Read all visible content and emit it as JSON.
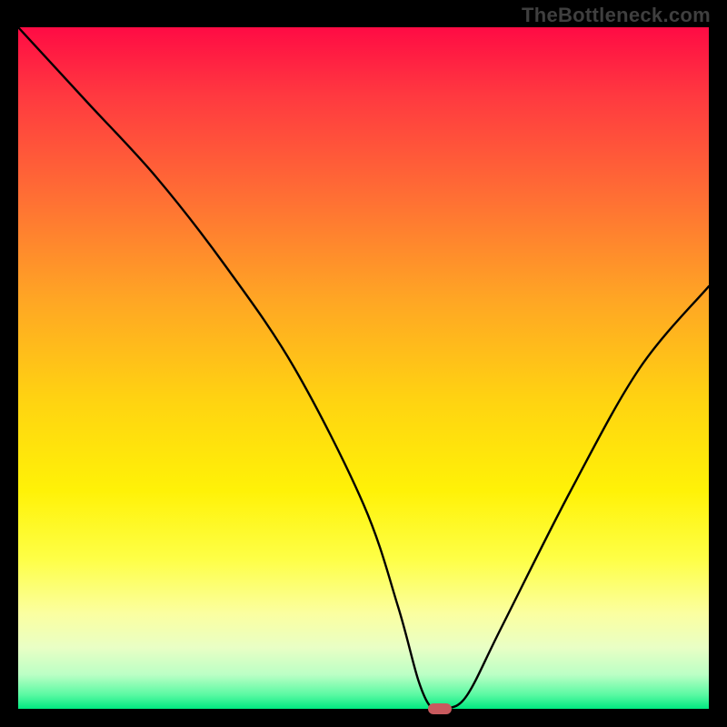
{
  "watermark": "TheBottleneck.com",
  "chart_data": {
    "type": "line",
    "title": "",
    "xlabel": "",
    "ylabel": "",
    "xlim": [
      0,
      100
    ],
    "ylim": [
      0,
      100
    ],
    "grid": false,
    "legend": false,
    "series": [
      {
        "name": "bottleneck-curve",
        "x": [
          0,
          10,
          20,
          30,
          40,
          50,
          55,
          58,
          60,
          62,
          65,
          70,
          80,
          90,
          100
        ],
        "y": [
          100,
          89,
          78,
          65,
          50,
          30,
          15,
          4,
          0,
          0,
          2,
          12,
          32,
          50,
          62
        ]
      }
    ],
    "annotations": [
      {
        "name": "optimal-marker",
        "x": 61,
        "y": 0,
        "color": "#c85a5e"
      }
    ],
    "background_gradient_stops": [
      {
        "pos": 0,
        "color": "#ff0b44"
      },
      {
        "pos": 10,
        "color": "#ff3940"
      },
      {
        "pos": 25,
        "color": "#ff6f34"
      },
      {
        "pos": 40,
        "color": "#ffa624"
      },
      {
        "pos": 55,
        "color": "#ffd411"
      },
      {
        "pos": 68,
        "color": "#fff207"
      },
      {
        "pos": 78,
        "color": "#feff46"
      },
      {
        "pos": 86,
        "color": "#fbffa0"
      },
      {
        "pos": 91,
        "color": "#e9ffc5"
      },
      {
        "pos": 95,
        "color": "#bbffc5"
      },
      {
        "pos": 98,
        "color": "#58f9a2"
      },
      {
        "pos": 100,
        "color": "#00e980"
      }
    ]
  }
}
